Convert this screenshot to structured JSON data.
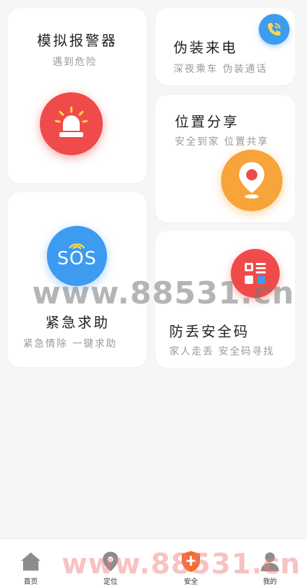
{
  "cards": {
    "alarm": {
      "title": "模拟报警器",
      "subtitle": "遇到危险"
    },
    "fake_call": {
      "title": "伪装来电",
      "subtitle": "深夜乘车 伪装通话"
    },
    "location_share": {
      "title": "位置分享",
      "subtitle": "安全到家 位置共享"
    },
    "sos": {
      "title": "紧急求助",
      "subtitle": "紧急情除 一键求助",
      "icon_text": "SOS"
    },
    "safety_code": {
      "title": "防丢安全码",
      "subtitle": "家人走丢 安全码寻找"
    }
  },
  "watermark": "www.88531.cn",
  "tabbar": {
    "tabs": [
      {
        "label": "首页",
        "icon": "home-icon",
        "active": false
      },
      {
        "label": "定位",
        "icon": "location-pin-icon",
        "active": false
      },
      {
        "label": "安全",
        "icon": "shield-icon",
        "active": true
      },
      {
        "label": "我的",
        "icon": "user-icon",
        "active": false
      }
    ]
  },
  "colors": {
    "alarm_red": "#f04b4b",
    "call_blue": "#3d9bf0",
    "location_orange": "#f7a43a",
    "sos_blue": "#3d9bf0",
    "code_red": "#f04b4b",
    "shield_orange": "#f26b2e"
  }
}
